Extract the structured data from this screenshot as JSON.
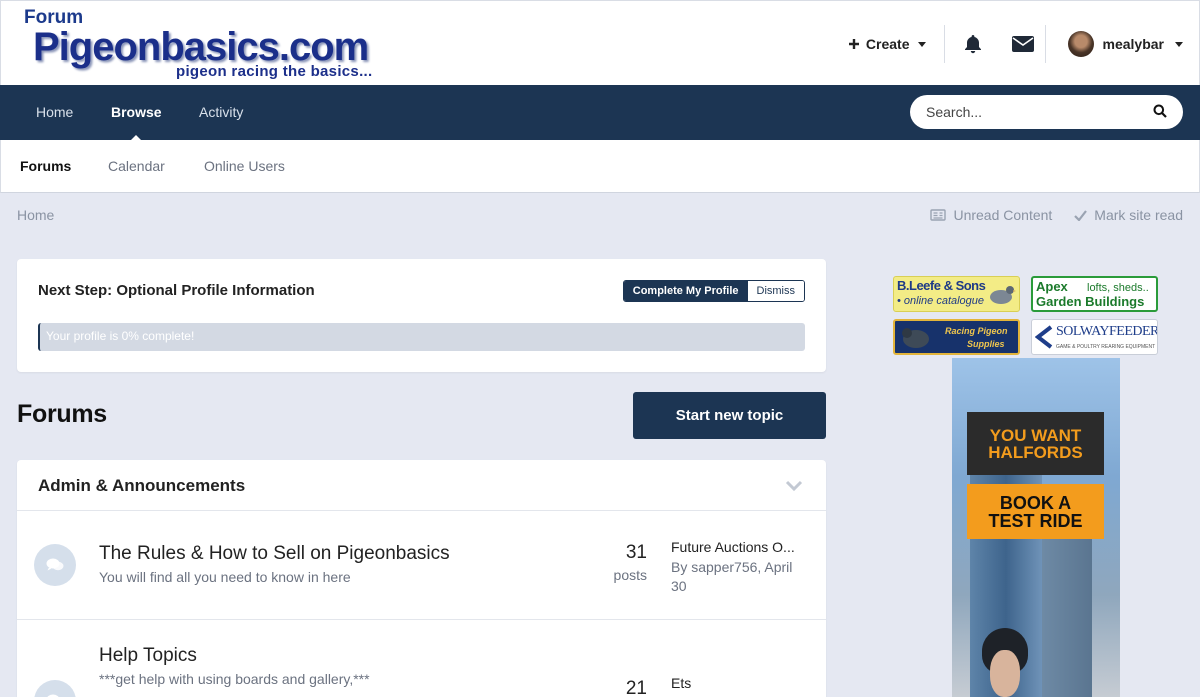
{
  "header": {
    "logo": {
      "line1": "Forum",
      "line2": "Pigeonbasics.com",
      "tagline": "pigeon racing the basics..."
    },
    "create_label": "Create",
    "username": "mealybar",
    "icons": {
      "create": "plus-icon",
      "notifications": "bell-icon",
      "messages": "envelope-icon"
    }
  },
  "nav": {
    "items": [
      {
        "label": "Home",
        "active": false
      },
      {
        "label": "Browse",
        "active": true
      },
      {
        "label": "Activity",
        "active": false
      }
    ],
    "search_placeholder": "Search..."
  },
  "subnav": {
    "items": [
      {
        "label": "Forums",
        "active": true
      },
      {
        "label": "Calendar",
        "active": false
      },
      {
        "label": "Online Users",
        "active": false
      }
    ]
  },
  "breadcrumb": {
    "home": "Home",
    "unread": "Unread Content",
    "mark_read": "Mark site read"
  },
  "profile": {
    "title": "Next Step: Optional Profile Information",
    "complete_button": "Complete My Profile",
    "dismiss_button": "Dismiss",
    "progress_text": "Your profile is 0% complete!",
    "progress_fraction": 0
  },
  "forums": {
    "heading": "Forums",
    "new_topic_button": "Start new topic",
    "category": {
      "title": "Admin & Announcements",
      "rows": [
        {
          "name": "The Rules & How to Sell on Pigeonbasics",
          "description": "You will find all you need to know in here",
          "count": "31",
          "count_label": "posts",
          "last_title": "Future Auctions O...",
          "last_by": "By sapper756, April 30"
        },
        {
          "name": "Help Topics",
          "description": "***get help with using boards and gallery,***",
          "count": "21",
          "count_label": "",
          "last_title": "Ets",
          "last_by": ""
        }
      ]
    }
  },
  "ads": {
    "ad1": {
      "line1": "B.Leefe & Sons",
      "line2": "• online catalogue"
    },
    "ad2": {
      "line1": "Apex",
      "line1b": "lofts, sheds..",
      "line2": "Garden Buildings"
    },
    "ad3": {
      "line1": "Racing Pigeon",
      "line2": "Supplies"
    },
    "ad4": {
      "line1": "SOLWAYFEEDERS",
      "line2": "GAME & POULTRY REARING EQUIPMENT"
    },
    "ad5": {
      "line1": "YOU WANT",
      "line2": "HALFORDS",
      "line3": "BOOK A",
      "line4": "TEST RIDE"
    }
  },
  "colors": {
    "nav_bg": "#1c3553",
    "page_bg": "#e5e8f2",
    "accent": "#1c3553"
  }
}
